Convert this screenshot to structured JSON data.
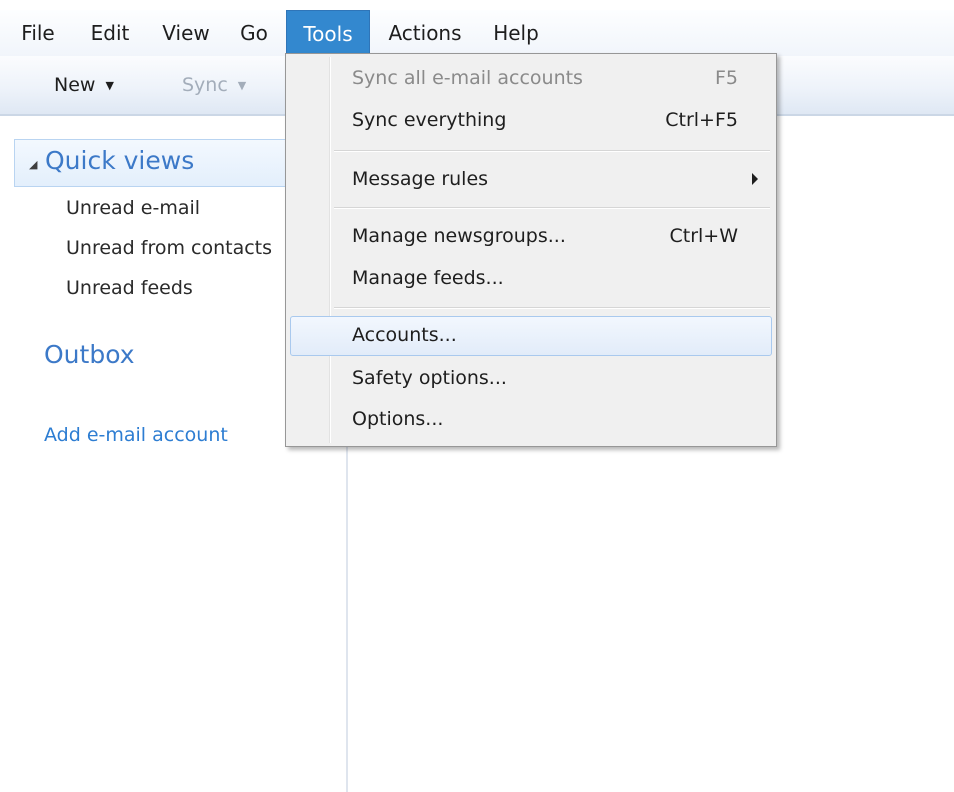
{
  "menubar": {
    "items": [
      {
        "label": "File"
      },
      {
        "label": "Edit"
      },
      {
        "label": "View"
      },
      {
        "label": "Go"
      },
      {
        "label": "Tools"
      },
      {
        "label": "Actions"
      },
      {
        "label": "Help"
      }
    ],
    "active": "Tools"
  },
  "toolbar": {
    "new_label": "New",
    "sync_label": "Sync"
  },
  "sidebar": {
    "quick_views_label": "Quick views",
    "items": [
      {
        "label": "Unread e-mail"
      },
      {
        "label": "Unread from contacts"
      },
      {
        "label": "Unread feeds"
      }
    ],
    "outbox_label": "Outbox",
    "add_account_label": "Add e-mail account"
  },
  "tools_menu": {
    "items": [
      {
        "label": "Sync all e-mail accounts",
        "shortcut": "F5",
        "disabled": true
      },
      {
        "label": "Sync everything",
        "shortcut": "Ctrl+F5"
      },
      {
        "label": "Message rules",
        "submenu": true
      },
      {
        "label": "Manage newsgroups...",
        "shortcut": "Ctrl+W"
      },
      {
        "label": "Manage feeds..."
      },
      {
        "label": "Accounts...",
        "highlighted": true
      },
      {
        "label": "Safety options..."
      },
      {
        "label": "Options..."
      }
    ]
  },
  "colors": {
    "menu_active_bg": "#3388cf",
    "link_blue": "#3c79c8",
    "highlight_border": "#a9c9ee"
  }
}
